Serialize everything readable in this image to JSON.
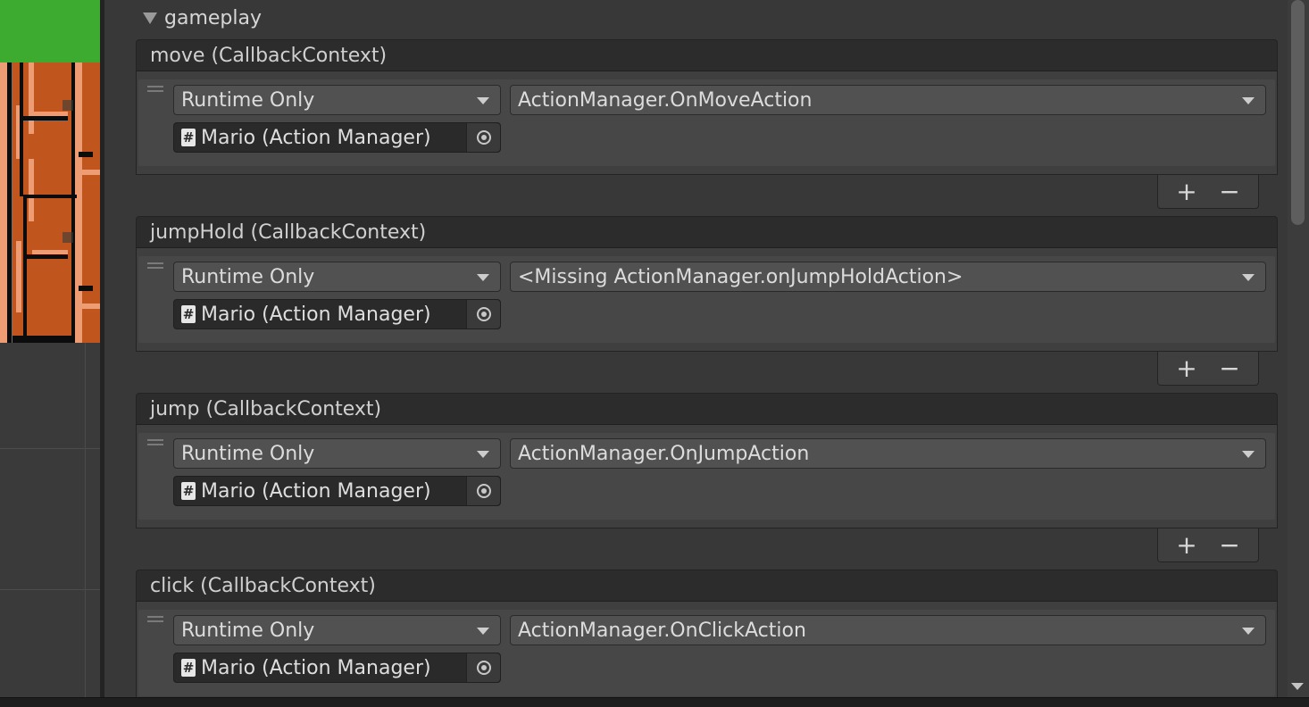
{
  "foldout": {
    "label": "gameplay"
  },
  "events": [
    {
      "header": "move (CallbackContext)",
      "runtime": "Runtime Only",
      "function": "ActionManager.OnMoveAction",
      "object": "Mario (Action Manager)",
      "add": "+",
      "remove": "−"
    },
    {
      "header": "jumpHold (CallbackContext)",
      "runtime": "Runtime Only",
      "function": "<Missing ActionManager.onJumpHoldAction>",
      "object": "Mario (Action Manager)",
      "add": "+",
      "remove": "−"
    },
    {
      "header": "jump (CallbackContext)",
      "runtime": "Runtime Only",
      "function": "ActionManager.OnJumpAction",
      "object": "Mario (Action Manager)",
      "add": "+",
      "remove": "−"
    },
    {
      "header": "click (CallbackContext)",
      "runtime": "Runtime Only",
      "function": "ActionManager.OnClickAction",
      "object": "Mario (Action Manager)",
      "add": "+",
      "remove": "−"
    }
  ],
  "colors": {
    "scene_green": "#3cab2f",
    "brick": "#c0561d",
    "brick_light": "#ee9c74",
    "panel": "#383838"
  },
  "icons": {
    "script": "hash-icon",
    "picker": "object-picker-icon",
    "foldout": "triangle-down-icon"
  }
}
